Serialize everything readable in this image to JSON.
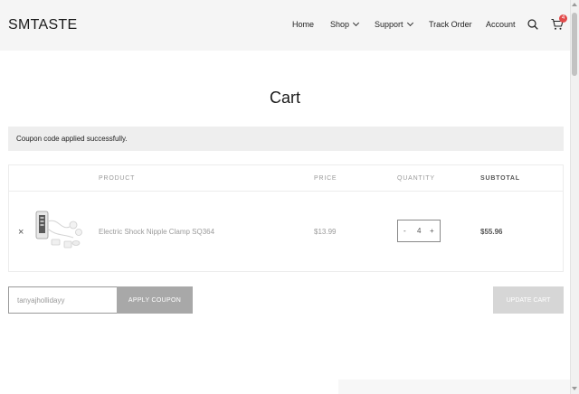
{
  "header": {
    "brand": "SMTASTE",
    "nav": [
      {
        "label": "Home",
        "dropdown": false
      },
      {
        "label": "Shop",
        "dropdown": true
      },
      {
        "label": "Support",
        "dropdown": true
      },
      {
        "label": "Track Order",
        "dropdown": false
      },
      {
        "label": "Account",
        "dropdown": false
      }
    ],
    "icons": [
      "search-icon",
      "cart-icon"
    ],
    "cart_count": "4",
    "badge_color": "#e24b4b"
  },
  "page": {
    "title": "Cart",
    "notice": "Coupon code applied successfully."
  },
  "table": {
    "headers": {
      "product": "PRODUCT",
      "price": "PRICE",
      "quantity": "QUANTITY",
      "subtotal": "SUBTOTAL"
    },
    "rows": [
      {
        "remove": "×",
        "name": "Electric Shock Nipple Clamp SQ364",
        "price": "$13.99",
        "qty_minus": "-",
        "quantity": "4",
        "qty_plus": "+",
        "subtotal": "$55.96"
      }
    ]
  },
  "coupon": {
    "value": "tanyajhollidayy",
    "apply_label": "APPLY COUPON"
  },
  "update_label": "UPDATE CART"
}
